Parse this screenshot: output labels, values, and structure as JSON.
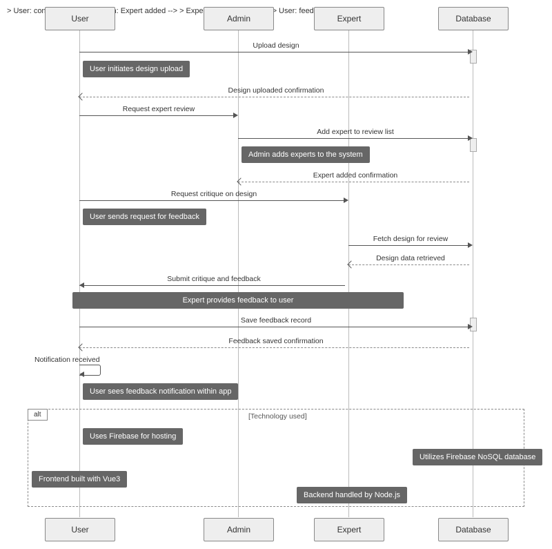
{
  "actors": {
    "user": "User",
    "admin": "Admin",
    "expert": "Expert",
    "database": "Database"
  },
  "messages": {
    "m1": "Upload design",
    "m2": "Design uploaded confirmation",
    "m3": "Request expert review",
    "m4": "Add expert to review list",
    "m5": "Expert added confirmation",
    "m6": "Request critique on design",
    "m7": "Fetch design for review",
    "m8": "Design data retrieved",
    "m9": "Submit critique and feedback",
    "m10": "Save feedback record",
    "m11": "Feedback saved confirmation",
    "m12": "Notification received"
  },
  "notes": {
    "n1": "User initiates design upload",
    "n2": "Admin adds experts to the system",
    "n3": "User sends request for feedback",
    "n4": "Expert provides feedback to user",
    "n5": "User sees feedback notification within app",
    "n6": "Uses Firebase for hosting",
    "n7": "Utilizes Firebase NoSQL database",
    "n8": "Frontend built with Vue3",
    "n9": "Backend handled by Node.js"
  },
  "alt": {
    "label": "alt",
    "title": "[Technology used]"
  }
}
